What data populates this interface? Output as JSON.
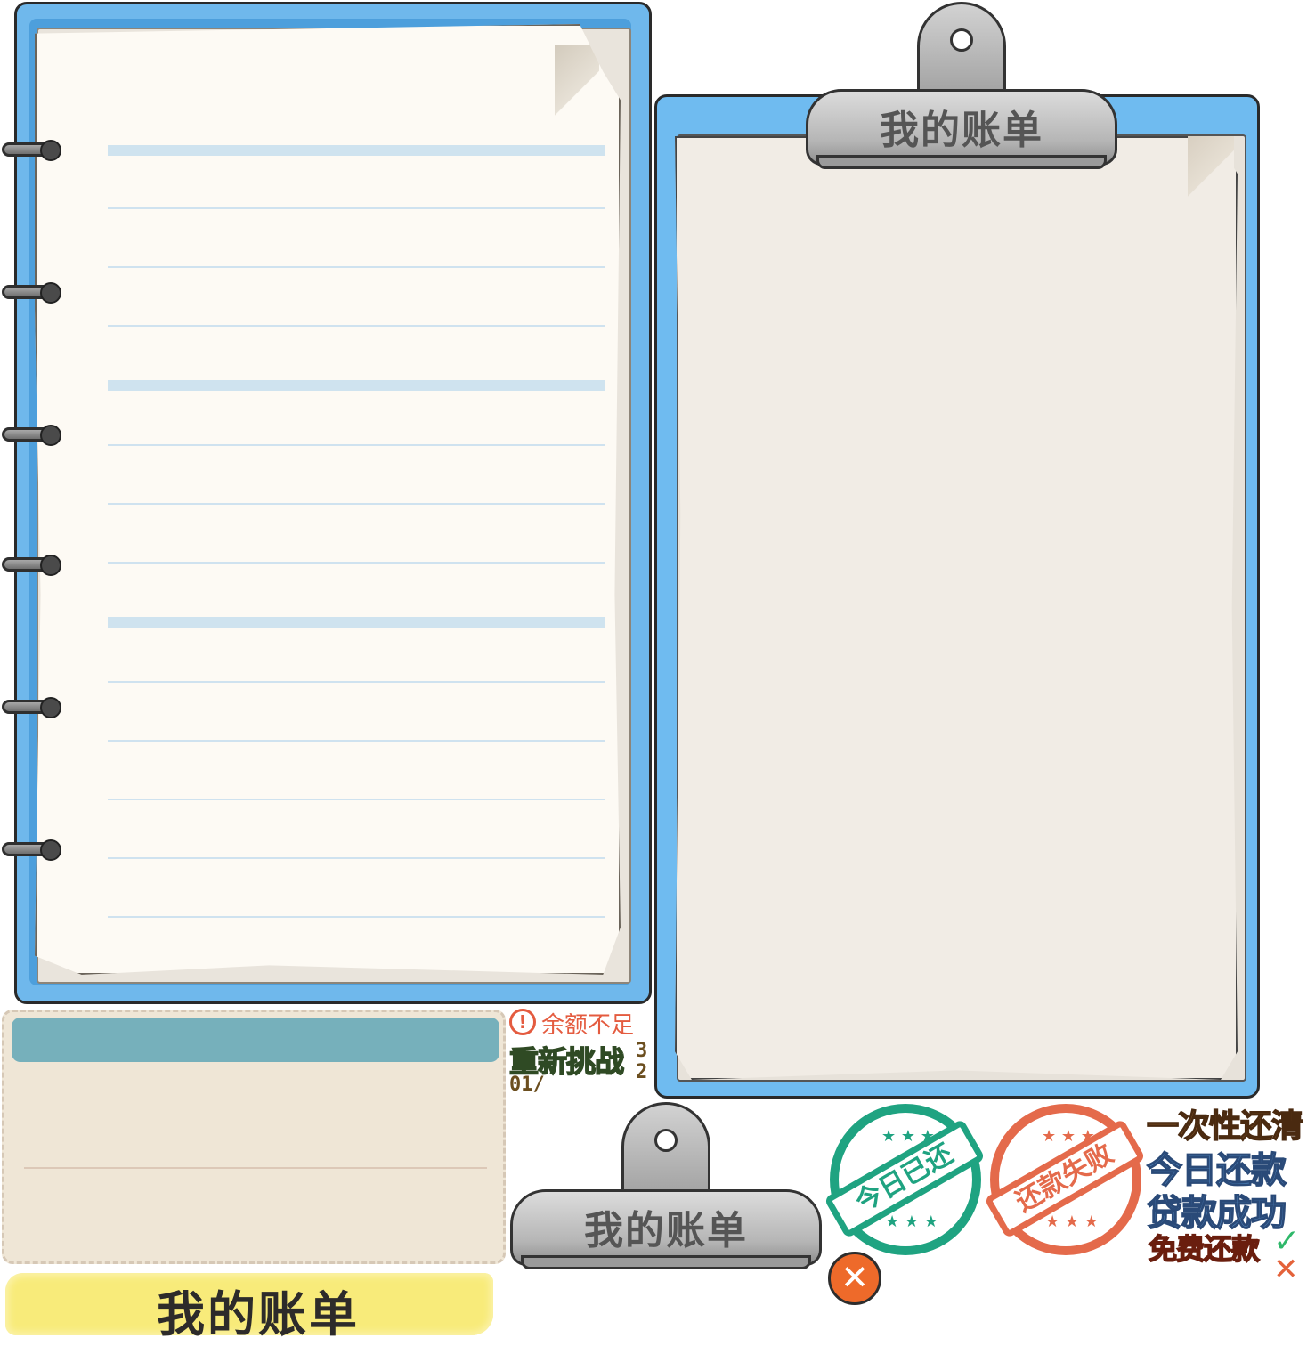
{
  "clipboard": {
    "title": "我的账单"
  },
  "clip_sprite": {
    "title": "我的账单"
  },
  "banner": {
    "title": "我的账单"
  },
  "warning": {
    "icon": "!",
    "text": "余额不足"
  },
  "retry": {
    "label": "重新挑战"
  },
  "digits": {
    "row1": "3",
    "row2": "2",
    "row3": "01/"
  },
  "stamps": {
    "paid_today": "今日已还",
    "repay_failed": "还款失败"
  },
  "labels": {
    "pay_all": "一次性还清",
    "repay_today": "今日还款",
    "loan_success": "贷款成功",
    "free_repay": "免费还款"
  },
  "icons": {
    "check": "✓",
    "cross": "✕",
    "close": "✕"
  },
  "colors": {
    "frame_blue": "#6fb8ec",
    "paper": "#fdfaf4",
    "stamp_green": "#1fa381",
    "stamp_orange": "#e46a4b"
  }
}
